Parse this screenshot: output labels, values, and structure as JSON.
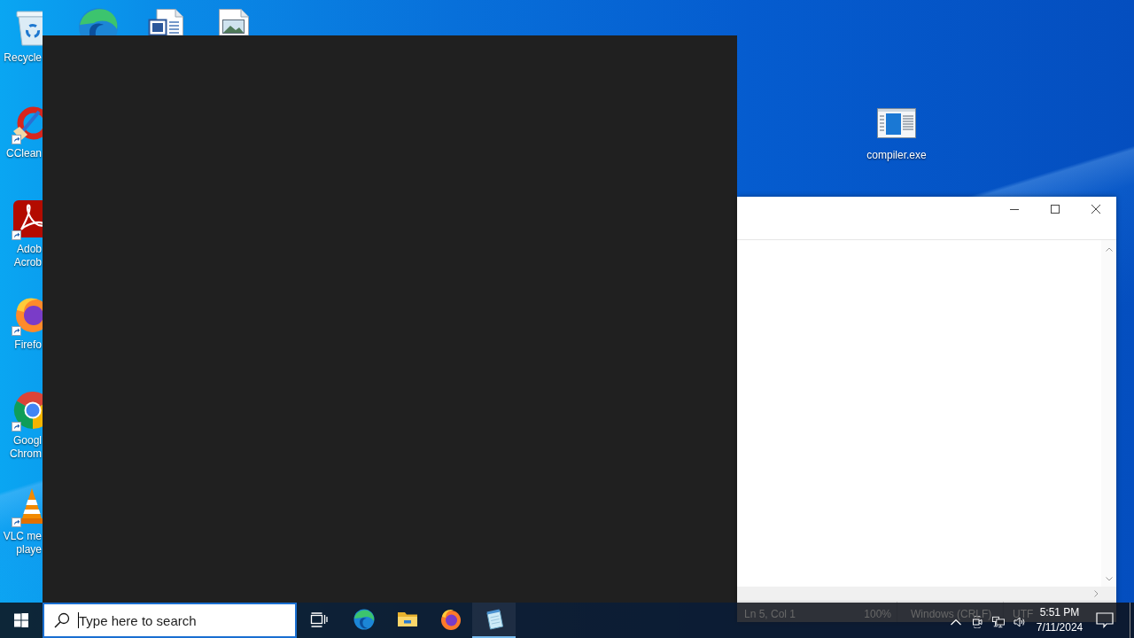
{
  "desktop": {
    "left_icons": [
      {
        "kind": "trash",
        "shortcut": false,
        "label_lines": [
          "Recycle"
        ]
      },
      {
        "kind": "brush",
        "shortcut": true,
        "label_lines": [
          "CClean"
        ]
      },
      {
        "kind": "swirl-tile",
        "shortcut": true,
        "label_lines": [
          "Adob",
          "Acrob"
        ]
      },
      {
        "kind": "flame-globe",
        "shortcut": true,
        "label_lines": [
          "Firefo"
        ]
      },
      {
        "kind": "ring",
        "shortcut": true,
        "label_lines": [
          "Googl",
          "Chrom"
        ]
      },
      {
        "kind": "cone",
        "shortcut": true,
        "label_lines": [
          "VLC me",
          "playe"
        ]
      }
    ],
    "top_icons": [
      {
        "kind": "swirl"
      },
      {
        "kind": "document"
      },
      {
        "kind": "picture"
      }
    ],
    "right_icon": {
      "kind": "program",
      "label": "compiler.exe"
    }
  },
  "notepad_window": {
    "status_bar": [
      "Ln 5, Col 1",
      "100%",
      "Windows (CRLF)",
      "UTF"
    ]
  },
  "taskbar": {
    "search": {
      "placeholder": "Type here to search",
      "focused": true
    },
    "apps": [
      {
        "kind": "swirl",
        "running": false
      },
      {
        "kind": "folder",
        "running": false
      },
      {
        "kind": "flame-globe",
        "running": false
      },
      {
        "kind": "notepad",
        "running": true
      }
    ],
    "clock": {
      "time": "5:51 PM",
      "date": "7/11/2024"
    }
  }
}
